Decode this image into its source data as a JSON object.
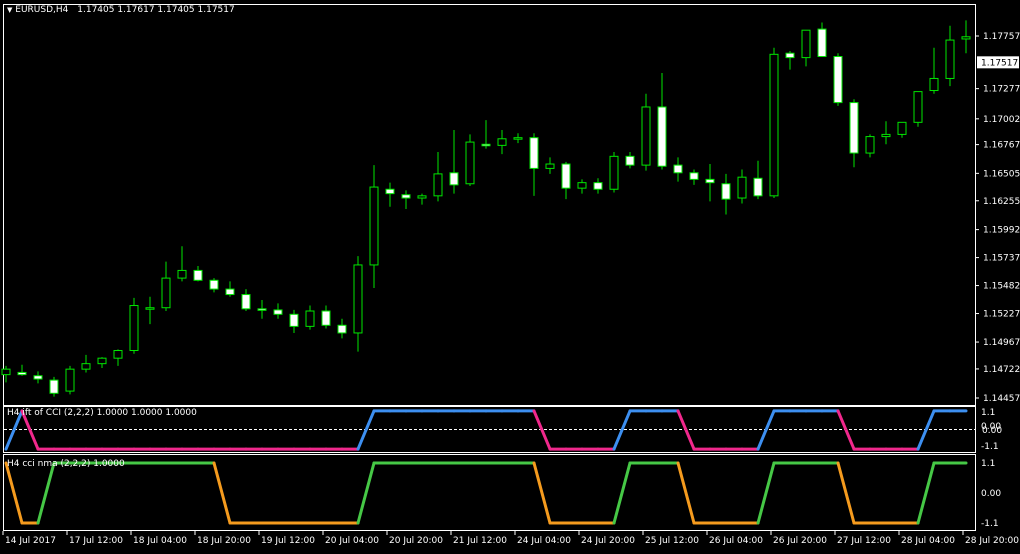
{
  "header": {
    "symbol_label": "EURUSD,H4",
    "ohlc": "1.17405 1.17617 1.17405 1.17517"
  },
  "colors": {
    "background": "#000000",
    "frame": "#ffffff",
    "bull_body": "#000000",
    "bear_body": "#ffffff",
    "wick": "#00e600",
    "ift_up": "#3d8ff0",
    "ift_down": "#f0288c",
    "nma_up": "#46c846",
    "nma_down": "#f59b1e",
    "level_line": "#ffffff"
  },
  "price_axis": {
    "ticks": [
      "1.17757",
      "1.17277",
      "1.17002",
      "1.16767",
      "1.16505",
      "1.16255",
      "1.15992",
      "1.15737",
      "1.15482",
      "1.15227",
      "1.14967",
      "1.14722",
      "1.14457"
    ],
    "current_price": "1.17517"
  },
  "time_axis": {
    "labels": [
      "14 Jul 2017",
      "17 Jul 12:00",
      "18 Jul 04:00",
      "18 Jul 20:00",
      "19 Jul 12:00",
      "20 Jul 04:00",
      "20 Jul 20:00",
      "21 Jul 12:00",
      "24 Jul 04:00",
      "24 Jul 20:00",
      "25 Jul 12:00",
      "26 Jul 04:00",
      "26 Jul 20:00",
      "27 Jul 12:00",
      "28 Jul 04:00",
      "28 Jul 20:00"
    ]
  },
  "indicator1": {
    "label": "H4 ift of CCI (2,2,2) 1.0000 1.0000 1.0000",
    "ticks": [
      "1.1",
      "-1.1"
    ],
    "overlap_ticks": [
      "0.00",
      "0.00"
    ]
  },
  "indicator2": {
    "label": "H4 cci nma (2,2,2) 1.0000",
    "ticks": [
      "1.1",
      "0.00",
      "-1.1"
    ]
  },
  "chart_data": [
    {
      "type": "candlestick",
      "title": "EURUSD,H4",
      "ylim": [
        1.14457,
        1.17757
      ],
      "ohlc": [
        [
          1.1467,
          1.1475,
          1.146,
          1.1472
        ],
        [
          1.1469,
          1.1476,
          1.1466,
          1.1467
        ],
        [
          1.1466,
          1.147,
          1.1459,
          1.1463
        ],
        [
          1.1462,
          1.1465,
          1.1447,
          1.145
        ],
        [
          1.1452,
          1.1475,
          1.1449,
          1.1472
        ],
        [
          1.1472,
          1.1485,
          1.1469,
          1.1477
        ],
        [
          1.1477,
          1.1483,
          1.1473,
          1.1482
        ],
        [
          1.1482,
          1.149,
          1.1475,
          1.1489
        ],
        [
          1.1489,
          1.1537,
          1.1486,
          1.153
        ],
        [
          1.1527,
          1.1538,
          1.1513,
          1.1528
        ],
        [
          1.1528,
          1.157,
          1.1525,
          1.1555
        ],
        [
          1.1555,
          1.1584,
          1.1552,
          1.1562
        ],
        [
          1.1562,
          1.1566,
          1.1552,
          1.1553
        ],
        [
          1.1553,
          1.1555,
          1.1542,
          1.1545
        ],
        [
          1.1545,
          1.1552,
          1.1538,
          1.154
        ],
        [
          1.154,
          1.1545,
          1.1525,
          1.1527
        ],
        [
          1.1527,
          1.1535,
          1.1518,
          1.1526
        ],
        [
          1.1526,
          1.1532,
          1.1518,
          1.1522
        ],
        [
          1.1522,
          1.1526,
          1.1505,
          1.1511
        ],
        [
          1.1511,
          1.153,
          1.1508,
          1.1525
        ],
        [
          1.1525,
          1.153,
          1.1509,
          1.1512
        ],
        [
          1.1512,
          1.1518,
          1.15,
          1.1505
        ],
        [
          1.1505,
          1.1575,
          1.1488,
          1.1567
        ],
        [
          1.1567,
          1.1658,
          1.1546,
          1.1638
        ],
        [
          1.1636,
          1.1642,
          1.162,
          1.1632
        ],
        [
          1.1631,
          1.1635,
          1.1618,
          1.1628
        ],
        [
          1.1628,
          1.1632,
          1.1622,
          1.163
        ],
        [
          1.163,
          1.167,
          1.1625,
          1.165
        ],
        [
          1.1651,
          1.169,
          1.1632,
          1.164
        ],
        [
          1.1641,
          1.1686,
          1.1639,
          1.1679
        ],
        [
          1.1677,
          1.1699,
          1.1673,
          1.1676
        ],
        [
          1.1676,
          1.169,
          1.1668,
          1.1682
        ],
        [
          1.1682,
          1.1687,
          1.1678,
          1.1683
        ],
        [
          1.1683,
          1.1687,
          1.163,
          1.1655
        ],
        [
          1.1655,
          1.1665,
          1.165,
          1.1659
        ],
        [
          1.1659,
          1.1661,
          1.1627,
          1.1637
        ],
        [
          1.1637,
          1.1645,
          1.1632,
          1.1642
        ],
        [
          1.1642,
          1.1646,
          1.1632,
          1.1636
        ],
        [
          1.1636,
          1.167,
          1.1633,
          1.1666
        ],
        [
          1.1666,
          1.167,
          1.1655,
          1.1658
        ],
        [
          1.1658,
          1.1723,
          1.1653,
          1.1711
        ],
        [
          1.1711,
          1.1742,
          1.1654,
          1.1657
        ],
        [
          1.1658,
          1.1665,
          1.1643,
          1.1651
        ],
        [
          1.1651,
          1.1654,
          1.164,
          1.1645
        ],
        [
          1.1645,
          1.1659,
          1.1625,
          1.1642
        ],
        [
          1.1641,
          1.165,
          1.1613,
          1.1627
        ],
        [
          1.1628,
          1.1654,
          1.1623,
          1.1647
        ],
        [
          1.1646,
          1.1662,
          1.1627,
          1.163
        ],
        [
          1.163,
          1.1765,
          1.1628,
          1.1759
        ],
        [
          1.176,
          1.1762,
          1.1745,
          1.1756
        ],
        [
          1.1756,
          1.178,
          1.1748,
          1.1781
        ],
        [
          1.1782,
          1.1788,
          1.1757,
          1.1757
        ],
        [
          1.1757,
          1.176,
          1.1712,
          1.1715
        ],
        [
          1.1715,
          1.1718,
          1.1656,
          1.1669
        ],
        [
          1.1669,
          1.1686,
          1.1665,
          1.1684
        ],
        [
          1.1684,
          1.1698,
          1.1677,
          1.1686
        ],
        [
          1.1686,
          1.1697,
          1.1683,
          1.1697
        ],
        [
          1.1697,
          1.1725,
          1.1693,
          1.1725
        ],
        [
          1.1726,
          1.1765,
          1.1723,
          1.1737
        ],
        [
          1.1737,
          1.1785,
          1.173,
          1.1772
        ],
        [
          1.1773,
          1.179,
          1.176,
          1.1775
        ]
      ]
    },
    {
      "type": "line",
      "title": "H4 ift of CCI (2,2,2) 1.0000 1.0000 1.0000",
      "ylim": [
        -1.1,
        1.1
      ],
      "values": [
        -1,
        1,
        -1,
        -1,
        -1,
        -1,
        -1,
        -1,
        -1,
        -1,
        -1,
        -1,
        -1,
        -1,
        -1,
        -1,
        -1,
        -1,
        -1,
        -1,
        -1,
        -1,
        -1,
        1,
        1,
        1,
        1,
        1,
        1,
        1,
        1,
        1,
        1,
        1,
        -1,
        -1,
        -1,
        -1,
        -1,
        1,
        1,
        1,
        1,
        -1,
        -1,
        -1,
        -1,
        -1,
        1,
        1,
        1,
        1,
        1,
        -1,
        -1,
        -1,
        -1,
        -1,
        1,
        1,
        1
      ]
    },
    {
      "type": "line",
      "title": "H4 cci nma (2,2,2) 1.0000",
      "ylim": [
        -1.1,
        1.1
      ],
      "values": [
        1,
        -1,
        -1,
        1,
        1,
        1,
        1,
        1,
        1,
        1,
        1,
        1,
        1,
        1,
        -1,
        -1,
        -1,
        -1,
        -1,
        -1,
        -1,
        -1,
        -1,
        1,
        1,
        1,
        1,
        1,
        1,
        1,
        1,
        1,
        1,
        1,
        -1,
        -1,
        -1,
        -1,
        -1,
        1,
        1,
        1,
        1,
        -1,
        -1,
        -1,
        -1,
        -1,
        1,
        1,
        1,
        1,
        1,
        -1,
        -1,
        -1,
        -1,
        -1,
        1,
        1,
        1
      ]
    }
  ]
}
